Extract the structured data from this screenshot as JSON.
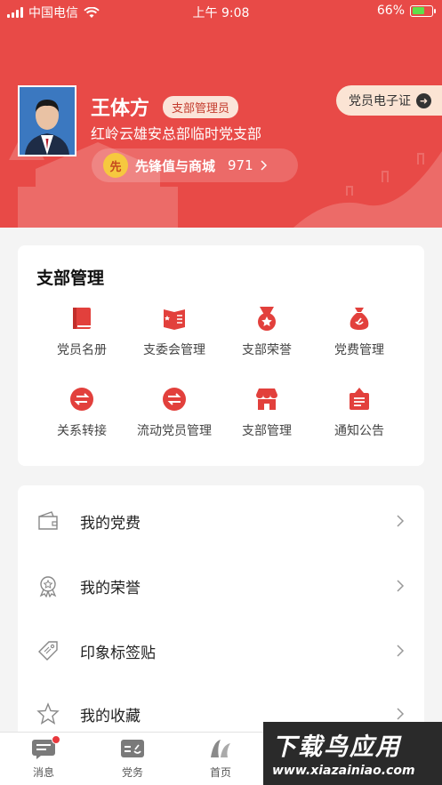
{
  "status_bar": {
    "carrier": "中国电信",
    "time": "上午 9:08",
    "battery": "66%"
  },
  "profile": {
    "name": "王体方",
    "role_badge": "支部管理员",
    "organization": "红岭云雄安总部临时党支部",
    "coin_glyph": "先",
    "pioneer_label": "先锋值与商城",
    "pioneer_score": "971",
    "ecard_label": "党员电子证"
  },
  "branch_management": {
    "title": "支部管理",
    "items": [
      {
        "label": "党员名册",
        "icon": "roster-book-icon"
      },
      {
        "label": "支委会管理",
        "icon": "committee-icon"
      },
      {
        "label": "支部荣誉",
        "icon": "medal-icon"
      },
      {
        "label": "党费管理",
        "icon": "money-bag-icon"
      },
      {
        "label": "关系转接",
        "icon": "transfer-icon"
      },
      {
        "label": "流动党员管理",
        "icon": "mobile-member-icon"
      },
      {
        "label": "支部管理",
        "icon": "store-icon"
      },
      {
        "label": "通知公告",
        "icon": "notice-icon"
      }
    ]
  },
  "list": {
    "items": [
      {
        "label": "我的党费",
        "icon": "wallet-icon"
      },
      {
        "label": "我的荣誉",
        "icon": "award-icon"
      },
      {
        "label": "印象标签贴",
        "icon": "tag-icon"
      },
      {
        "label": "我的收藏",
        "icon": "star-icon"
      }
    ]
  },
  "tabbar": {
    "tabs": [
      {
        "label": "消息",
        "icon": "message-icon"
      },
      {
        "label": "党务",
        "icon": "party-affairs-icon"
      },
      {
        "label": "首页",
        "icon": "home-logo-icon"
      }
    ]
  },
  "watermark": {
    "line1": "下载鸟应用",
    "line2": "www.xiazainiao.com"
  },
  "colors": {
    "primary_red": "#e84a47",
    "card_bg": "#ffffff",
    "page_bg": "#f4f4f4",
    "coin": "#f6c83f",
    "ecard_bg": "#fbe4d4"
  }
}
